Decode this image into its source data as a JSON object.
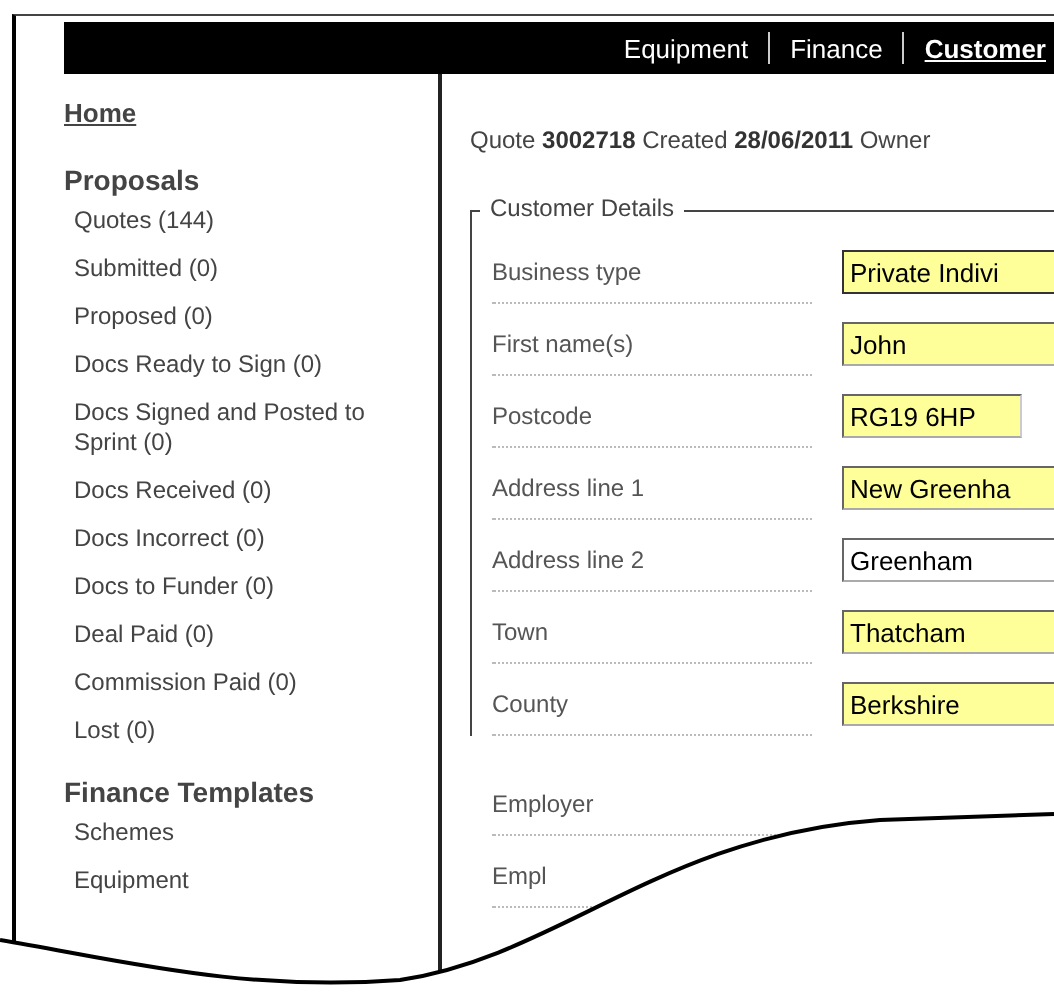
{
  "nav_tabs": [
    {
      "label": "Equipment",
      "selected": false
    },
    {
      "label": "Finance",
      "selected": false
    },
    {
      "label": "Customer",
      "selected": true
    }
  ],
  "sidebar": {
    "home": "Home",
    "sections": [
      {
        "title": "Proposals",
        "items": [
          "Quotes (144)",
          "Submitted (0)",
          "Proposed (0)",
          "Docs Ready to Sign (0)",
          "Docs Signed and Posted to Sprint (0)",
          "Docs Received (0)",
          "Docs Incorrect (0)",
          "Docs to Funder (0)",
          "Deal Paid (0)",
          "Commission Paid (0)",
          "Lost (0)"
        ]
      },
      {
        "title": "Finance Templates",
        "items": [
          "Schemes",
          "Equipment"
        ]
      }
    ]
  },
  "quote_line": "Quote **3002718** Created **28/06/2011** Owner",
  "customer_details": {
    "legend": "Customer Details",
    "fields": [
      {
        "label": "Business type",
        "value": "Private Indivi",
        "kind": "select",
        "highlighted": true
      },
      {
        "label": "First name(s)",
        "value": "John",
        "kind": "text",
        "highlighted": true
      },
      {
        "label": "Postcode",
        "value": "RG19 6HP",
        "kind": "short",
        "highlighted": true
      },
      {
        "label": "Address line 1",
        "value": "New Greenha",
        "kind": "text",
        "highlighted": true
      },
      {
        "label": "Address line 2",
        "value": "Greenham",
        "kind": "text",
        "highlighted": false
      },
      {
        "label": "Town",
        "value": "Thatcham",
        "kind": "text",
        "highlighted": true
      },
      {
        "label": "County",
        "value": "Berkshire",
        "kind": "text",
        "highlighted": true
      }
    ]
  },
  "employment_fields": [
    {
      "label": "Employer"
    },
    {
      "label": "Empl"
    }
  ]
}
